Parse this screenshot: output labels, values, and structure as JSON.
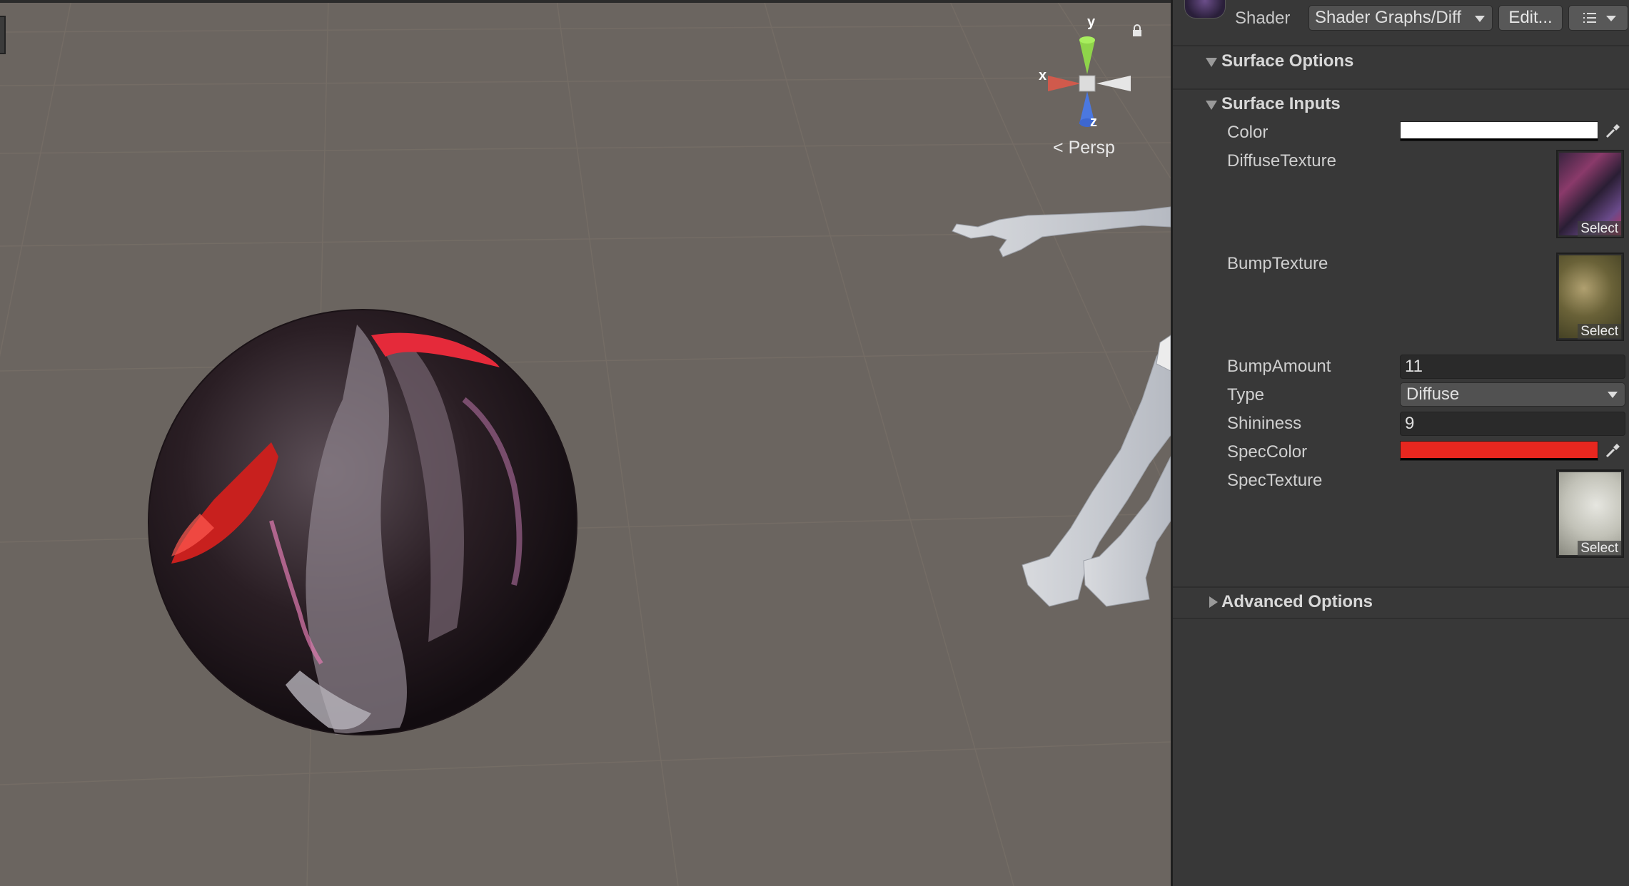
{
  "scene": {
    "view_mode": "Persp",
    "axes": {
      "x": "x",
      "y": "y",
      "z": "z"
    }
  },
  "inspector": {
    "shader_label": "Shader",
    "shader_value": "Shader Graphs/Diff",
    "edit_button": "Edit...",
    "sections": {
      "surface_options": "Surface Options",
      "surface_inputs": "Surface Inputs",
      "advanced_options": "Advanced Options"
    },
    "properties": {
      "color": {
        "label": "Color",
        "value": "#FFFFFF"
      },
      "diffuse_texture": {
        "label": "DiffuseTexture",
        "select": "Select"
      },
      "bump_texture": {
        "label": "BumpTexture",
        "select": "Select"
      },
      "bump_amount": {
        "label": "BumpAmount",
        "value": "11"
      },
      "type": {
        "label": "Type",
        "value": "Diffuse"
      },
      "shininess": {
        "label": "Shininess",
        "value": "9"
      },
      "spec_color": {
        "label": "SpecColor",
        "value": "#E8271F"
      },
      "spec_texture": {
        "label": "SpecTexture",
        "select": "Select"
      }
    }
  }
}
